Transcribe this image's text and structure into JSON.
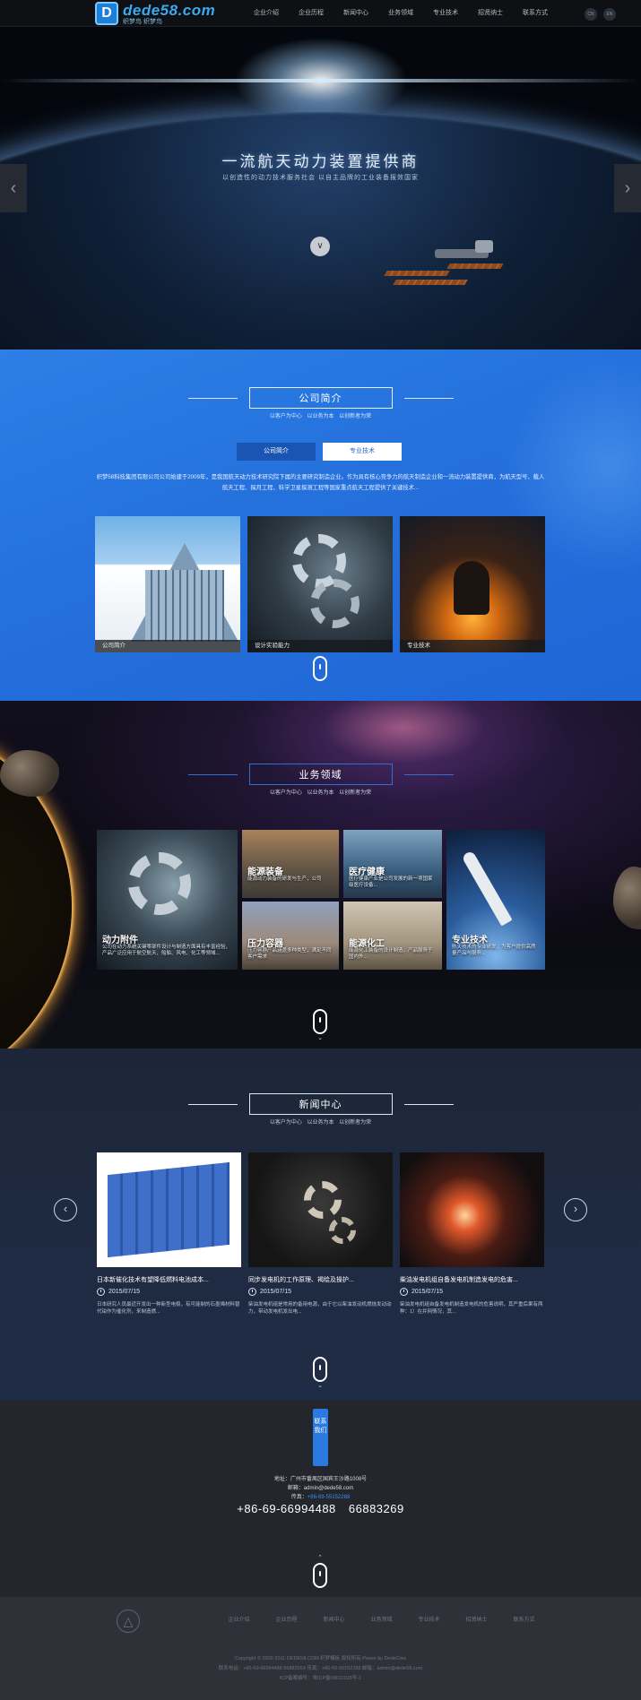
{
  "header": {
    "logo_text": "dede58.com",
    "logo_sub": "织梦鸟 织梦鸟",
    "nav": [
      "企业介绍",
      "企业历程",
      "新闻中心",
      "业务领域",
      "专业技术",
      "招贤纳士",
      "联系方式"
    ],
    "lang": [
      "CN",
      "EN"
    ]
  },
  "banner": {
    "title": "一流航天动力装置提供商",
    "subtitle": "以创造性的动力技术服务社会 以自主品牌的工业装备报效国家",
    "prev_icon": "chevron-left-icon",
    "next_icon": "chevron-right-icon"
  },
  "company": {
    "title": "公司简介",
    "subtitle": "以客户为中心 以业务为本 以创新者为荣",
    "tabs": [
      "公司简介",
      "专业技术"
    ],
    "description": "织梦58科技集团有限公司公司始建于2009年，是我国航天动力技术研究院下属的主要研究制造企业。作为具有核心竞争力的航天制造企业和一流动力装置提供商，为航天型号、载人航天工程、探月工程、科学卫星探测工程等国家重点航天工程提供了关键技术...",
    "cards": [
      {
        "label": "公司简介"
      },
      {
        "label": "设计实验能力"
      },
      {
        "label": "专业技术"
      }
    ]
  },
  "business": {
    "title": "业务领域",
    "subtitle": "以客户为中心 以业务为本 以创新者为荣",
    "items": [
      {
        "name": "动力附件",
        "desc": "公司在动力系统关键零部件设计与制造方面具有丰富经验，产品广泛应用于航空航天、船舶、风电、化工等领域..."
      },
      {
        "name": "能源装备",
        "desc": "能源动力装备的研发与生产，公司"
      },
      {
        "name": "医疗健康",
        "desc": "医疗健康产业是公司发展的新一项国家级医疗设备..."
      },
      {
        "name": "压力容器",
        "desc": "压力容器产品涵盖多种类型，满足不同客户需求"
      },
      {
        "name": "能源化工",
        "desc": "能源化工装备的设计制造，产品服务于国内外..."
      },
      {
        "name": "专业技术",
        "desc": "航天技术的专业研发，为客户提供高质量产品与服务..."
      }
    ]
  },
  "news": {
    "title": "新闻中心",
    "subtitle": "以客户为中心 以业务为本 以创新者为荣",
    "items": [
      {
        "title": "日本新催化技术有望降低燃料电池成本...",
        "date": "2015/07/15",
        "summary": "日本研究人员最近开发出一种新型电极，有可能制的石墨烯材料替代铂作为催化剂，来制造燃..."
      },
      {
        "title": "同步发电机的工作原理、褐绘及操护...",
        "date": "2015/07/15",
        "summary": "柴油发电机组是常用的备用电源，由于它以柴油发动机燃烧发动动力，带动发电机发出电..."
      },
      {
        "title": "柴油发电机组自备发电机制造发电的危害...",
        "date": "2015/07/15",
        "summary": "柴油发电机组自备发电机制造发电机的危害说明，其严重后果有两种：1）在并网情况，其..."
      }
    ]
  },
  "contact": {
    "badge": "联系我们",
    "address": "地址：广州市番禺区国宾王沙路1008号",
    "email": "邮箱：admin@dede58.com",
    "fax_label": "传真：",
    "fax": "+86-69-55152288",
    "phone": "+86-69-66994488    66883269"
  },
  "footer": {
    "nav": [
      "企业介绍",
      "企业历程",
      "新闻中心",
      "业务领域",
      "专业技术",
      "招贤纳士",
      "联系方式"
    ],
    "copyright": "Copyright © 2002-2011 DEDE58.COM 织梦模板 版权所有   Power by DedeCms",
    "contact_line": "联系电话：+86-69-66994488   66883269 传真：+86-69-55152288 邮箱：admin@dede58.com",
    "icp": "ICP备案编号：粤ICP备09011015号-1"
  },
  "colors": {
    "brand_blue": "#2a7ae2",
    "company_bg": "#2470dc",
    "news_bg": "#1f2b42",
    "footer_bg": "#2e3137"
  }
}
